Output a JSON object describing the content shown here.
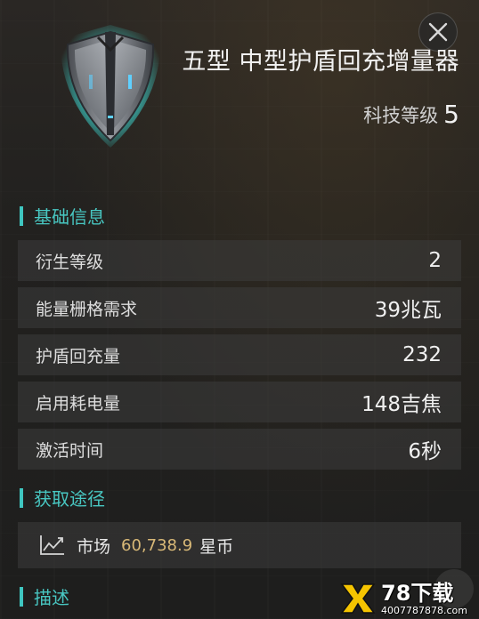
{
  "item": {
    "title": "五型 中型护盾回充增量器",
    "tech_label": "科技等级",
    "tech_value": "5",
    "icon": "shield-icon"
  },
  "sections": {
    "basic": "基础信息",
    "source": "获取途径",
    "description": "描述"
  },
  "stats": [
    {
      "label": "衍生等级",
      "value": "2"
    },
    {
      "label": "能量栅格需求",
      "value": "39兆瓦"
    },
    {
      "label": "护盾回充量",
      "value": "232"
    },
    {
      "label": "启用耗电量",
      "value": "148吉焦"
    },
    {
      "label": "激活时间",
      "value": "6秒"
    }
  ],
  "source": {
    "icon": "market-chart-icon",
    "label": "市场",
    "price": "60,738.9",
    "currency": "星币"
  },
  "watermark": {
    "main": "78下载",
    "sub": "4007787878.com"
  },
  "colors": {
    "accent": "#48c7c2",
    "price": "#d8b877",
    "row_bg": "#3c3c3c"
  }
}
